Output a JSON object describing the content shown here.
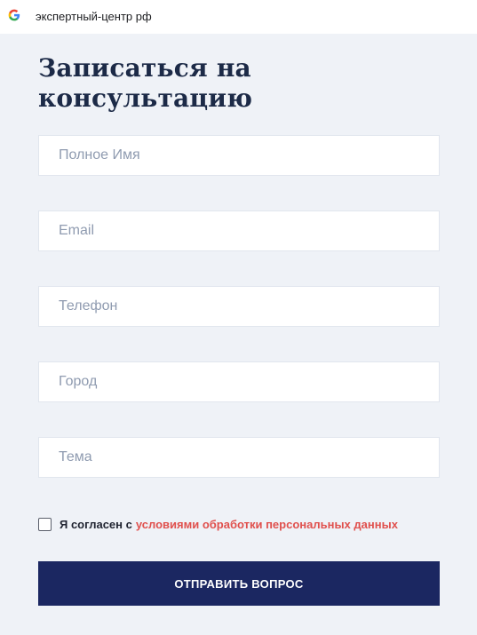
{
  "tab": {
    "site_title": "экспертный-центр рф"
  },
  "form": {
    "title": "Записаться на консультацию",
    "fields": [
      {
        "placeholder": "Полное Имя",
        "value": ""
      },
      {
        "placeholder": "Email",
        "value": ""
      },
      {
        "placeholder": "Телефон",
        "value": ""
      },
      {
        "placeholder": "Город",
        "value": ""
      },
      {
        "placeholder": "Тема",
        "value": ""
      }
    ],
    "consent": {
      "checked": false,
      "text": "Я согласен с",
      "link": "условиями обработки персональных данных"
    },
    "submit_label": "ОТПРАВИТЬ ВОПРОС"
  },
  "colors": {
    "background": "#eff2f7",
    "heading": "#1c2a47",
    "link": "#e0504d",
    "button": "#1b2761"
  },
  "icons": {
    "favicon": "google-g-icon"
  }
}
